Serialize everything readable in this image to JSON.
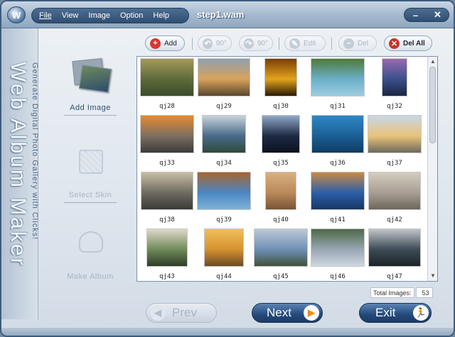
{
  "app": {
    "title_doc": "step1.wam"
  },
  "menu": {
    "items": [
      "File",
      "View",
      "Image",
      "Option",
      "Help"
    ]
  },
  "window_controls": {
    "minimize": "–",
    "close": "✕"
  },
  "left_panel": {
    "vertical_title": "Web Album Maker",
    "vertical_subtitle": "Generate Digital Photo Gallery with Clicks!",
    "steps": {
      "add": "Add  Image",
      "skin": "Select  Skin",
      "make": "Make  Album"
    }
  },
  "toolbar": {
    "add": "Add",
    "rotate_left": "90°",
    "rotate_right": "90°",
    "edit": "Edit",
    "del": "Del",
    "del_all": "Del All"
  },
  "gallery": {
    "images": [
      "qj28",
      "qj29",
      "qj30",
      "qj31",
      "qj32",
      "qj33",
      "qj34",
      "qj35",
      "qj36",
      "qj37",
      "qj38",
      "qj39",
      "qj40",
      "qj41",
      "qj42",
      "qj43",
      "qj44",
      "qj45",
      "qj46",
      "qj47"
    ]
  },
  "footer": {
    "total_label": "Total Images:",
    "total_value": "53",
    "prev": "Prev",
    "next": "Next",
    "exit": "Exit"
  },
  "colors": {
    "accent": "#24497a",
    "delete_red": "#c8322b",
    "add_red": "#d9362e"
  }
}
